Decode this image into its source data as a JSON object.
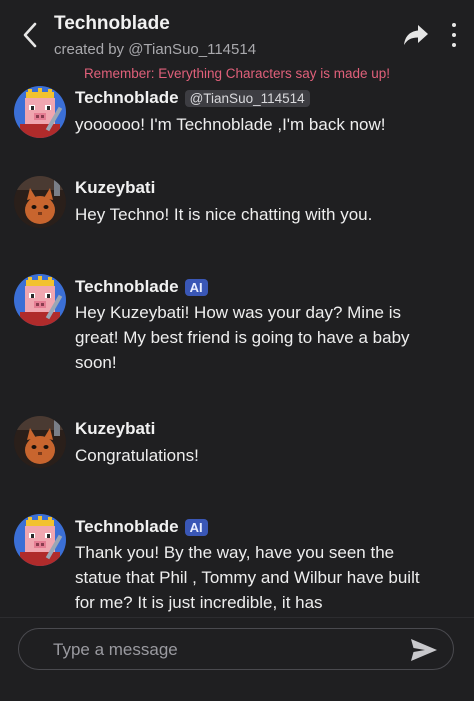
{
  "header": {
    "title": "Technoblade",
    "subtitle": "created by @TianSuo_114514",
    "disclaimer": "Remember: Everything Characters say is made up!"
  },
  "messages": [
    {
      "sender": "Technoblade",
      "tag": "@TianSuo_114514",
      "text": "yoooooo! I'm Technoblade ,I'm back now!"
    },
    {
      "sender": "Kuzeybati",
      "text": "Hey Techno! It is nice chatting with you."
    },
    {
      "sender": "Technoblade",
      "badge": "AI",
      "text": "Hey Kuzeybati! How was your day? Mine is great! My best friend is going to have a baby soon!"
    },
    {
      "sender": "Kuzeybati",
      "text": "Congratulations!"
    },
    {
      "sender": "Technoblade",
      "badge": "AI",
      "text": "Thank you! By the way, have you seen the statue that Phil , Tommy and Wilbur have built for me? It is just incredible, it has"
    }
  ],
  "composer": {
    "placeholder": "Type a message"
  },
  "icons": {
    "back": "chevron-left-icon",
    "share": "share-arrow-icon",
    "more": "more-vertical-icon",
    "send": "send-icon"
  },
  "colors": {
    "background": "#1f1f21",
    "disclaimer": "#e0607a",
    "ai_badge": "#3a57b6"
  }
}
